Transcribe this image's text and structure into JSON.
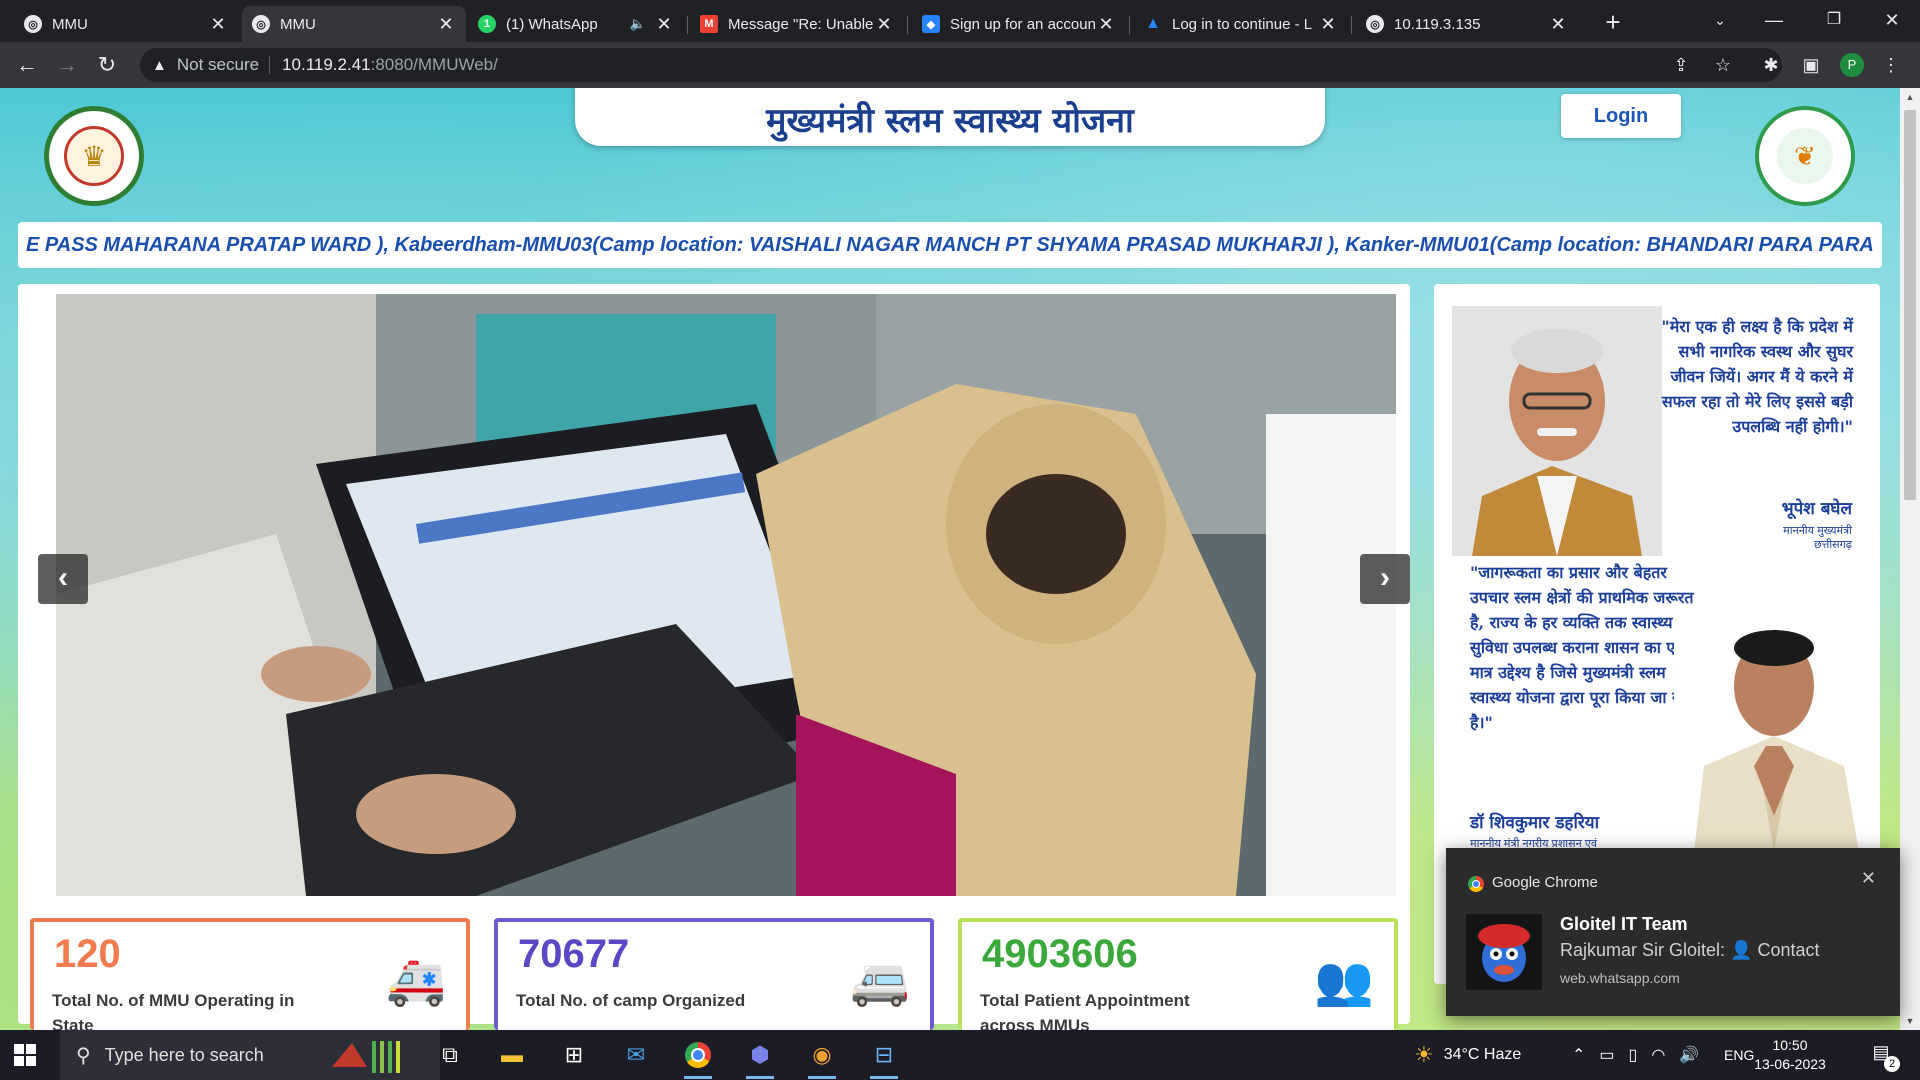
{
  "browser": {
    "tabs": [
      {
        "title": "MMU",
        "favicon": "globe-icon",
        "active": false
      },
      {
        "title": "MMU",
        "favicon": "globe-icon",
        "active": true
      },
      {
        "title": "(1) WhatsApp",
        "favicon": "whatsapp-icon",
        "active": false,
        "muted": true
      },
      {
        "title": "Message \"Re: Unable",
        "favicon": "gmail-icon",
        "active": false
      },
      {
        "title": "Sign up for an accoun",
        "favicon": "jira-icon",
        "active": false
      },
      {
        "title": "Log in to continue - L",
        "favicon": "atlassian-icon",
        "active": false
      },
      {
        "title": "10.119.3.135",
        "favicon": "globe-icon",
        "active": false
      }
    ],
    "address": {
      "security_label": "Not secure",
      "host": "10.119.2.41",
      "path": ":8080/MMUWeb/"
    },
    "profile_initial": "P"
  },
  "page": {
    "title": "मुख्यमंत्री स्लम स्वास्थ्य योजना",
    "login_label": "Login",
    "ticker_text": "E PASS MAHARANA PRATAP WARD ), Kabeerdham-MMU03(Camp location: VAISHALI NAGAR MANCH PT SHYAMA PRASAD MUKHARJI ), Kanker-MMU01(Camp location: BHANDARI PARA PARA",
    "carousel": {
      "prev": "‹",
      "next": "›"
    },
    "stats": [
      {
        "value": "120",
        "label": "Total No. of MMU Operating in State",
        "color": "#f07b4f",
        "icon": "ambulance-icon"
      },
      {
        "value": "70677",
        "label": "Total No. of camp Organized",
        "color": "#6f5bd0",
        "icon": "medical-van-icon"
      },
      {
        "value": "4903606",
        "label": "Total Patient Appointment across MMUs",
        "color": "#3aa83a",
        "icon": "users-icon"
      }
    ],
    "side": {
      "quote1": "\"मेरा एक ही लक्ष्य है कि प्रदेश में सभी नागरिक स्वस्थ और सुघर जीवन जियें। अगर मैं ये करने में सफल रहा तो मेरे लिए इससे बड़ी उपलब्धि नहीं होगी।\"",
      "sig1_name": "भूपेश बघेल",
      "sig1_title_line1": "माननीय मुख्यमंत्री",
      "sig1_title_line2": "छत्तीसगढ़",
      "quote2": "\"जागरूकता का प्रसार और बेहतर उपचार स्लम क्षेत्रों की प्राथमिक जरूरत है, राज्य के हर व्यक्ति तक स्वास्थ्य सुविधा उपलब्ध कराना शासन का एक मात्र उद्देश्य है जिसे मुख्यमंत्री स्लम स्वास्थ्य योजना द्वारा पूरा किया जा रहा है।\"",
      "sig2_name": "डॉ शिवकुमार डहरिया",
      "sig2_title": "माननीय मंत्री नगरीय प्रशासन एवं"
    }
  },
  "notification": {
    "app": "Google Chrome",
    "sender": "Gloitel IT Team",
    "message": "Rajkumar Sir Gloitel: 👤 Contact",
    "source": "web.whatsapp.com"
  },
  "taskbar": {
    "search_placeholder": "Type here to search",
    "weather": "34°C  Haze",
    "language": "ENG",
    "time": "10:50",
    "date": "13-06-2023",
    "notification_count": "2"
  }
}
